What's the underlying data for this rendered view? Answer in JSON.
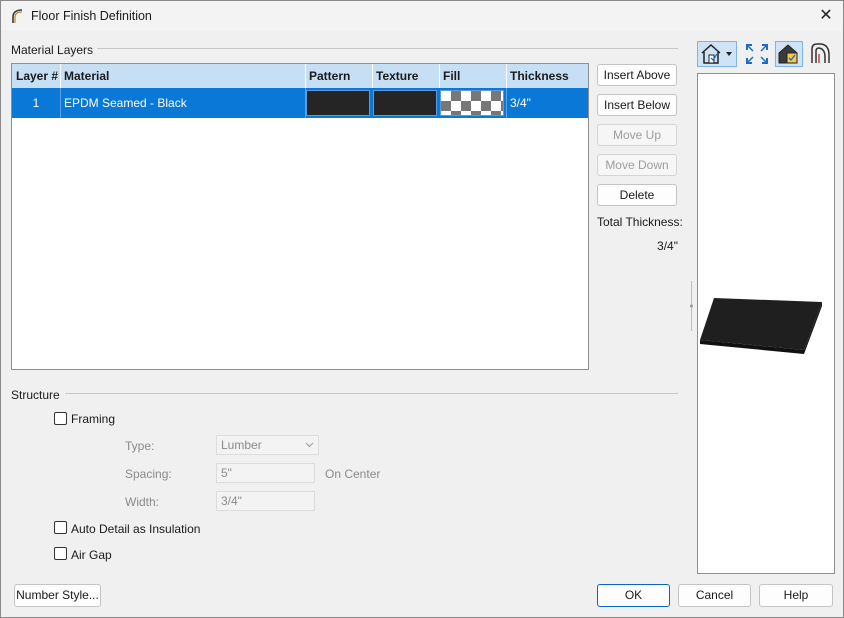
{
  "window": {
    "title": "Floor Finish Definition",
    "close_glyph": "✕"
  },
  "material_layers": {
    "label": "Material Layers",
    "columns": [
      "Layer #",
      "Material",
      "Pattern",
      "Texture",
      "Fill",
      "Thickness"
    ],
    "rows": [
      {
        "layer": "1",
        "material": "EPDM Seamed - Black",
        "pattern_color": "#252525",
        "texture_color": "#252525",
        "fill": "checker",
        "thickness": "3/4\""
      }
    ]
  },
  "side_buttons": {
    "insert_above": "Insert Above",
    "insert_below": "Insert Below",
    "move_up": "Move Up",
    "move_down": "Move Down",
    "delete": "Delete"
  },
  "total": {
    "label": "Total Thickness:",
    "value": "3/4\""
  },
  "toolbar": {
    "icons": [
      "house-view-icon",
      "dropdown-arrow-icon",
      "fit-to-window-icon",
      "color-on-icon",
      "layers-view-icon"
    ]
  },
  "structure": {
    "label": "Structure",
    "framing": {
      "label": "Framing",
      "checked": false
    },
    "type": {
      "label": "Type:",
      "value": "Lumber"
    },
    "spacing": {
      "label": "Spacing:",
      "value": "5\"",
      "suffix": "On Center"
    },
    "width": {
      "label": "Width:",
      "value": "3/4\""
    },
    "auto_detail": {
      "label": "Auto Detail as Insulation",
      "checked": false
    },
    "air_gap": {
      "label": "Air Gap",
      "checked": false
    }
  },
  "footer": {
    "number_style": "Number Style...",
    "ok": "OK",
    "cancel": "Cancel",
    "help": "Help"
  },
  "colors": {
    "selection": "#0a78d7",
    "header": "#c7dff4",
    "accent_border": "#0a64c8"
  }
}
